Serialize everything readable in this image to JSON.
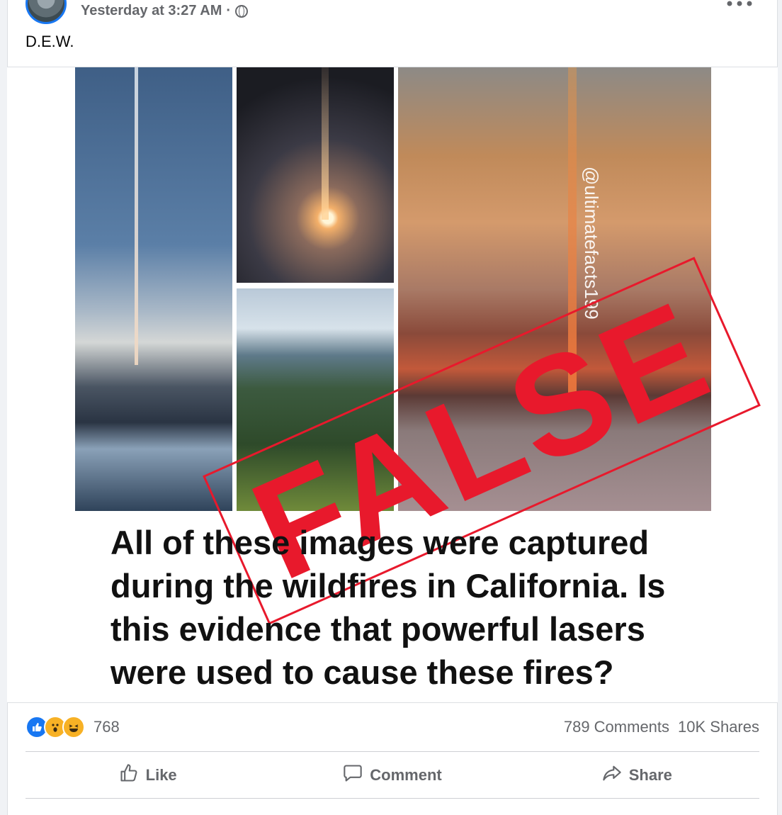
{
  "post": {
    "timestamp": "Yesterday at 3:27 AM",
    "separator": "·",
    "caption": "D.E.W.",
    "more_icon": "more-icon"
  },
  "image": {
    "watermark": "@ultimatefacts199",
    "stamp": "FALSE",
    "question": "All of these images were captured during the wildfires in California. Is this evidence that powerful lasers were used to cause these fires?"
  },
  "stats": {
    "reaction_count": "768",
    "comments": "789 Comments",
    "shares": "10K Shares",
    "reactions": [
      "like-reaction-icon",
      "wow-reaction-icon",
      "haha-reaction-icon"
    ]
  },
  "actions": {
    "like": "Like",
    "comment": "Comment",
    "share": "Share"
  },
  "colors": {
    "brand": "#1877f2",
    "stamp": "#e8192c",
    "muted": "#65676b"
  }
}
